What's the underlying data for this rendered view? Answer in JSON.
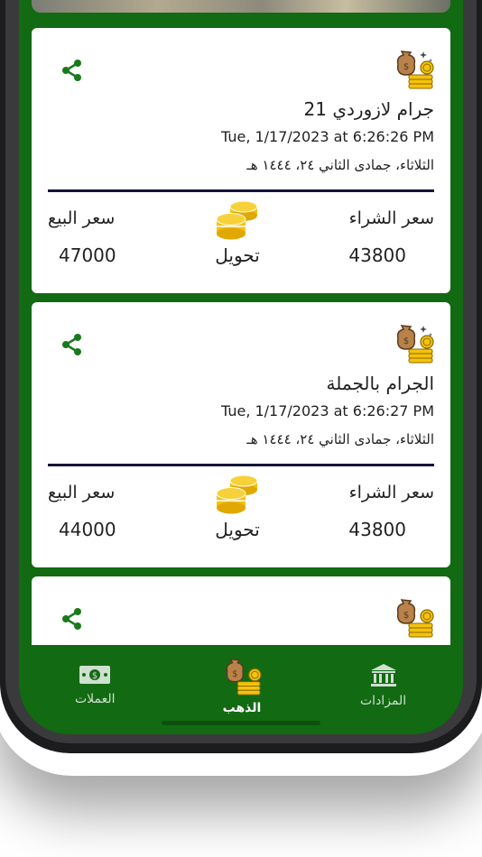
{
  "cards": [
    {
      "title": "جرام لازوردي 21",
      "date": "Tue, 1/17/2023 at 6:26:26 PM",
      "hijri": "الثلاثاء، جمادى الثاني ٢٤، ١٤٤٤ هـ",
      "buy_label": "سعر الشراء",
      "sell_label": "سعر البيع",
      "buy_value": "43800",
      "sell_value": "47000",
      "convert_label": "تحويل"
    },
    {
      "title": "الجرام بالجملة",
      "date": "Tue, 1/17/2023 at 6:26:27 PM",
      "hijri": "الثلاثاء، جمادى الثاني ٢٤، ١٤٤٤ هـ",
      "buy_label": "سعر الشراء",
      "sell_label": "سعر البيع",
      "buy_value": "43800",
      "sell_value": "44000",
      "convert_label": "تحويل"
    }
  ],
  "nav": {
    "currencies": "العملات",
    "gold": "الذهب",
    "auctions": "المزادات",
    "active": "gold"
  },
  "colors": {
    "brand_green": "#126a12",
    "share_green": "#1a7a1a",
    "coin_gold": "#f4c20d",
    "divider": "#14143a"
  },
  "icons": {
    "share": "share-icon",
    "gold_bag": "gold-bag-icon",
    "coins": "coin-stack-icon",
    "currencies": "banknote-icon",
    "auctions": "bank-icon"
  }
}
